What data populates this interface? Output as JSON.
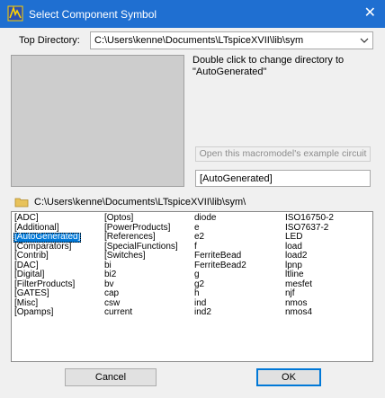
{
  "window": {
    "title": "Select Component Symbol",
    "close_glyph": "✕"
  },
  "top_directory": {
    "label": "Top Directory:",
    "value": "C:\\Users\\kenne\\Documents\\LTspiceXVII\\lib\\sym"
  },
  "description": "Double click to change directory to \"AutoGenerated\"",
  "example_button": {
    "label": "Open this macromodel's example circuit"
  },
  "subdirectory_value": "[AutoGenerated]",
  "current_path": "C:\\Users\\kenne\\Documents\\LTspiceXVII\\lib\\sym\\",
  "list": {
    "columns": [
      [
        "[ADC]",
        "[Additional]",
        "[AutoGenerated]",
        "[Comparators]",
        "[Contrib]",
        "[DAC]",
        "[Digital]",
        "[FilterProducts]",
        "[GATES]",
        "[Misc]",
        "[Opamps]"
      ],
      [
        "[Optos]",
        "[PowerProducts]",
        "[References]",
        "[SpecialFunctions]",
        "[Switches]",
        "bi",
        "bi2",
        "bv",
        "cap",
        "csw",
        "current"
      ],
      [
        "diode",
        "e",
        "e2",
        "f",
        "FerriteBead",
        "FerriteBead2",
        "g",
        "g2",
        "h",
        "ind",
        "ind2"
      ],
      [
        "ISO16750-2",
        "ISO7637-2",
        "LED",
        "load",
        "load2",
        "lpnp",
        "ltline",
        "mesfet",
        "njf",
        "nmos",
        "nmos4"
      ]
    ],
    "selected": "[AutoGenerated]"
  },
  "buttons": {
    "cancel": "Cancel",
    "ok": "OK"
  },
  "icons": {
    "app": "ltspice-logo-icon",
    "dropdown": "chevron-down-icon",
    "folder": "folder-icon"
  },
  "colors": {
    "title_bar": "#1f6fd1",
    "selection": "#0078d7",
    "preview": "#cdcdcd"
  }
}
